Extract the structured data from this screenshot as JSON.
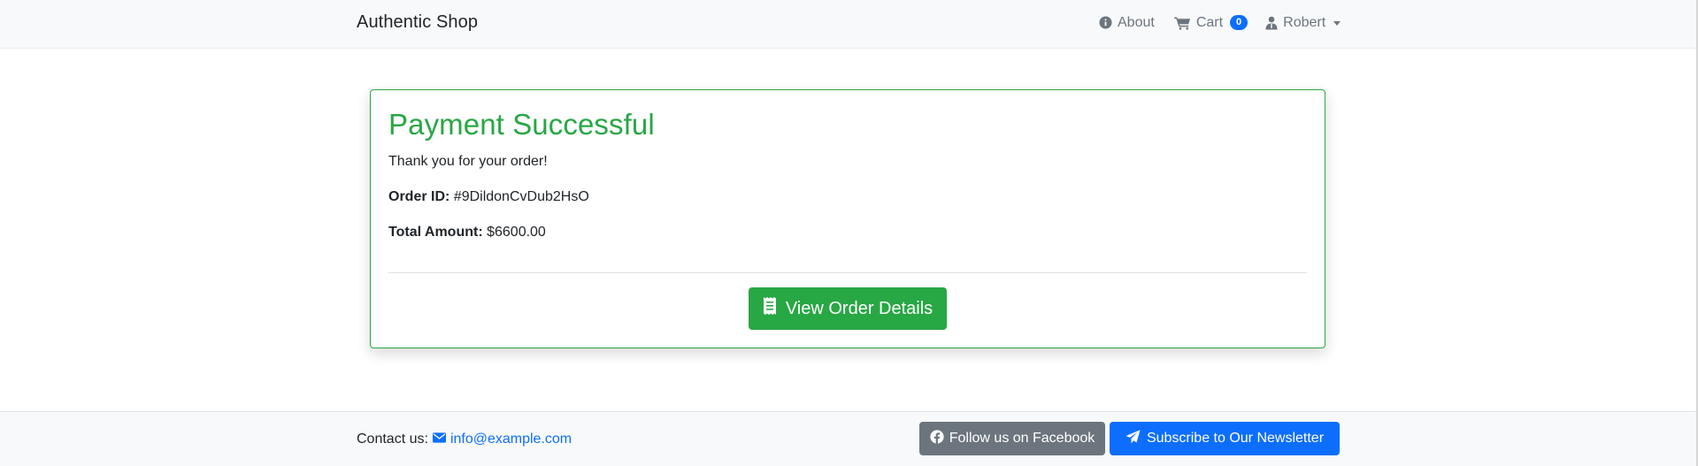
{
  "navbar": {
    "brand": "Authentic Shop",
    "links": {
      "about": "About",
      "cart": "Cart",
      "cart_count": "0",
      "user": "Robert"
    },
    "icons": {
      "about": "info-circle-icon",
      "cart": "cart-icon",
      "user": "user-icon"
    }
  },
  "card": {
    "title": "Payment Successful",
    "message": "Thank you for your order!",
    "order_id_label": "Order ID:",
    "order_id_value": "#9DildonCvDub2HsO",
    "total_label": "Total Amount:",
    "total_value": "$6600.00",
    "button_label": "View Order Details",
    "button_icon": "receipt-icon"
  },
  "footer": {
    "contact_label": "Contact us:",
    "contact_email": "info@example.com",
    "facebook_label": "Follow us on Facebook",
    "newsletter_label": "Subscribe to Our Newsletter"
  },
  "colors": {
    "success": "#28a745",
    "primary": "#0d6efd",
    "secondary": "#6c757d",
    "navbar_bg": "#f8f9fa"
  }
}
